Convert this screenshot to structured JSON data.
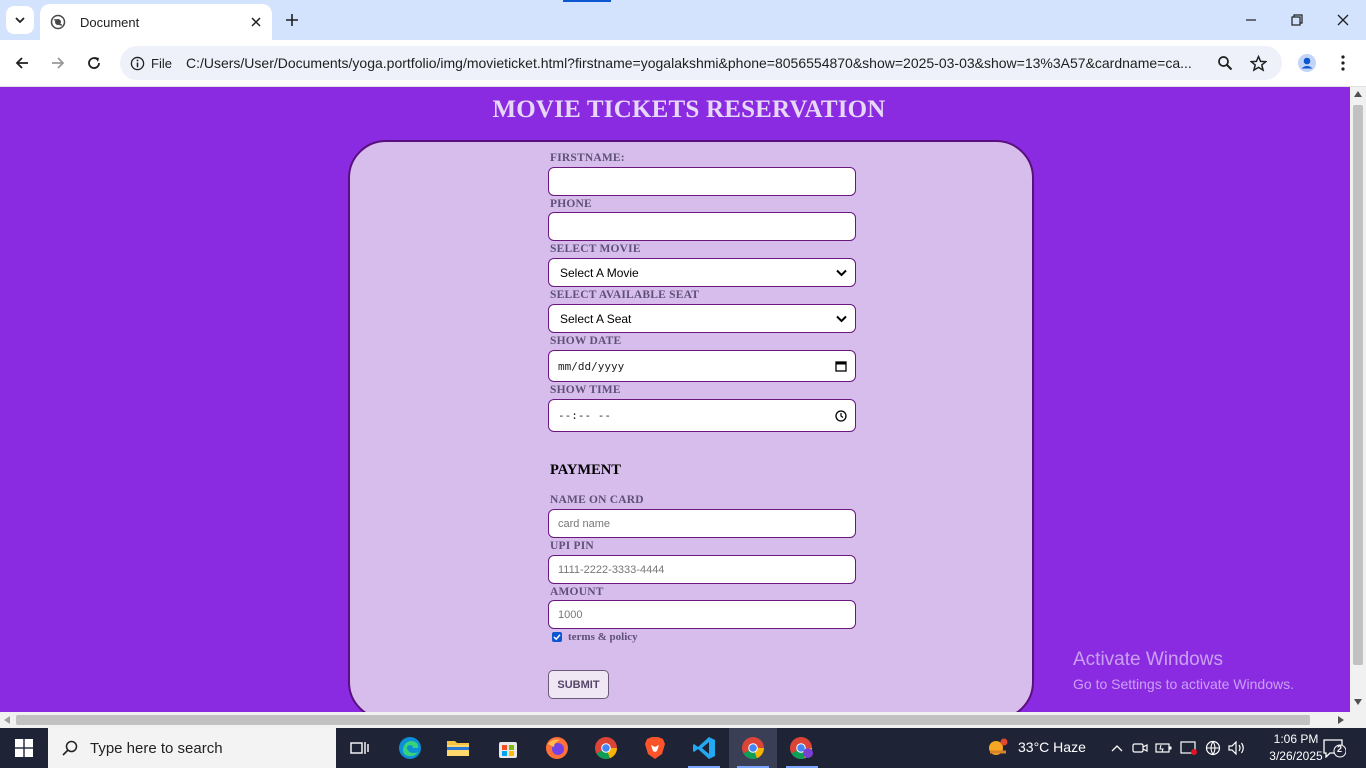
{
  "browser": {
    "tab_title": "Document",
    "site_chip_label": "File",
    "url": "C:/Users/User/Documents/yoga.portfolio/img/movieticket.html?firstname=yogalakshmi&phone=8056554870&show=2025-03-03&show=13%3A57&cardname=ca..."
  },
  "page": {
    "title": "MOVIE TICKETS RESERVATION",
    "labels": {
      "firstname": "FIRSTNAME:",
      "phone": "PHONE",
      "movie": "SELECT MOVIE",
      "seat": "SELECT AVAILABLE SEAT",
      "date": "SHOW DATE",
      "time": "SHOW TIME",
      "card_name": "NAME ON CARD",
      "upi": "UPI PIN",
      "amount": "AMOUNT"
    },
    "movie_select_value": "Select A Movie",
    "seat_select_value": "Select A Seat",
    "date_placeholder": "mm/dd/yyyy",
    "time_placeholder": "--:-- --",
    "payment_heading": "PAYMENT",
    "card_name_placeholder": "card name",
    "upi_placeholder": "1111-2222-3333-4444",
    "amount_placeholder": "1000",
    "terms_label": "terms & policy",
    "terms_checked": true,
    "submit_label": "SUBMIT"
  },
  "watermark": {
    "title": "Activate Windows",
    "subtitle": "Go to Settings to activate Windows."
  },
  "taskbar": {
    "search_placeholder": "Type here to search",
    "weather": "33°C  Haze",
    "time": "1:06 PM",
    "date": "3/26/2025",
    "notification_count": "2"
  },
  "colors": {
    "page_bg": "#8a2be2",
    "card_bg": "#d7bdec",
    "card_border": "#5a0f7e"
  }
}
